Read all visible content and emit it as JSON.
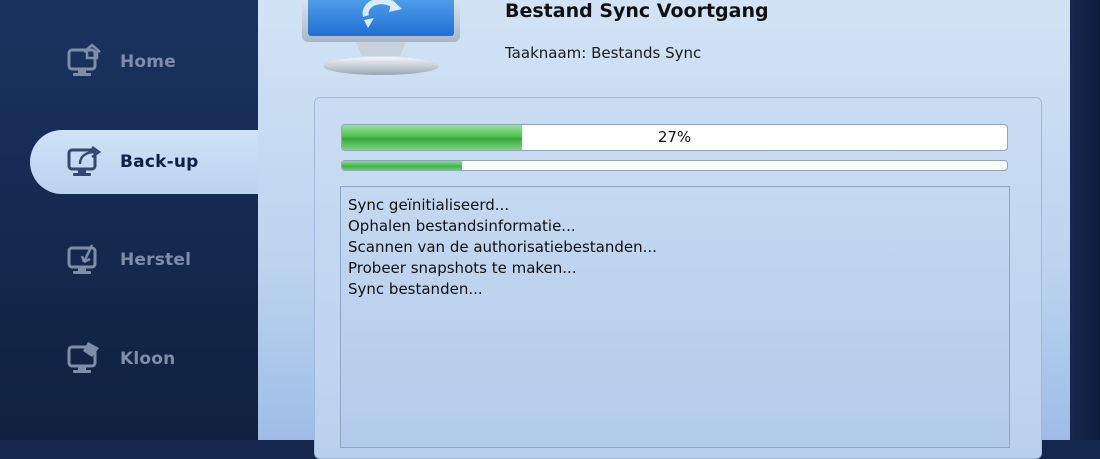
{
  "sidebar": {
    "items": [
      {
        "label": "Home",
        "icon": "home-monitor-icon",
        "active": false
      },
      {
        "label": "Back-up",
        "icon": "backup-monitor-icon",
        "active": true
      },
      {
        "label": "Herstel",
        "icon": "restore-monitor-icon",
        "active": false
      },
      {
        "label": "Kloon",
        "icon": "clone-monitor-icon",
        "active": false
      }
    ]
  },
  "header": {
    "title": "Bestand Sync Voortgang",
    "task_name": "Taaknaam: Bestands Sync",
    "icon": "sync-monitor-icon"
  },
  "progress": {
    "overall_label": "27%",
    "overall_fraction": 0.27,
    "current_fraction": 0.18
  },
  "log": {
    "lines": [
      "Sync geïnitialiseerd...",
      "Ophalen bestandsinformatie...",
      "Scannen van de authorisatiebestanden...",
      "Probeer snapshots te maken...",
      "Sync bestanden..."
    ]
  },
  "colors": {
    "sidebar_bg": "#15294f",
    "active_tab_bg": "#c4daf2",
    "content_bg": "#c6dbf2",
    "progress_green": "#3fb342"
  }
}
